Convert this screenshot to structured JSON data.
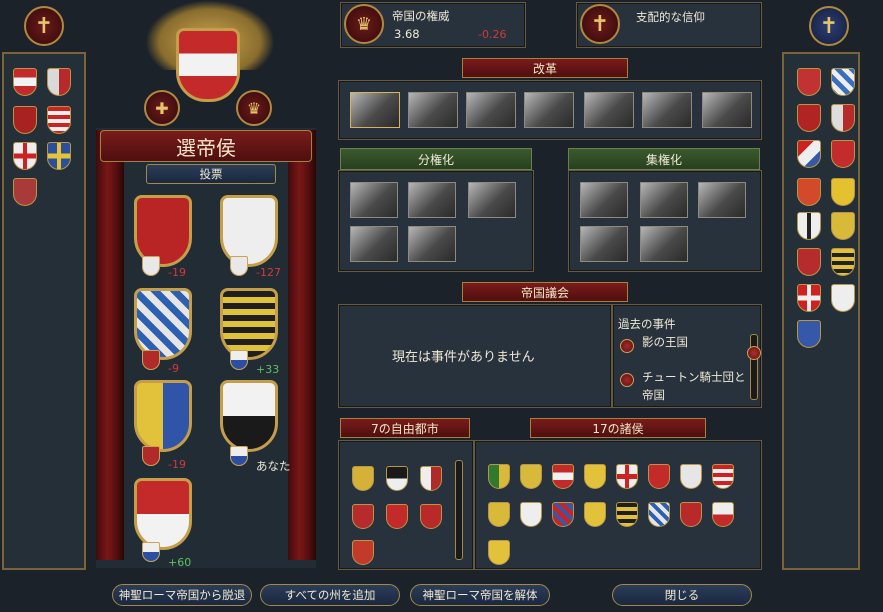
{
  "top_stats": {
    "authority_label": "帝国の権威",
    "authority_value": "3.68",
    "authority_change": "-0.26",
    "faith_label": "支配的な信仰"
  },
  "electors": {
    "title": "選帝侯",
    "vote_label": "投票",
    "entries": [
      {
        "change": "-19"
      },
      {
        "change": "-127"
      },
      {
        "change": "-9"
      },
      {
        "change": "+33"
      },
      {
        "change": "-19"
      },
      {
        "change": "あなた"
      },
      {
        "change": "+60"
      }
    ]
  },
  "reforms": {
    "title": "改革",
    "decentralize_label": "分権化",
    "centralize_label": "集権化"
  },
  "diet": {
    "title": "帝国議会",
    "empty_text": "現在は事件がありません",
    "past_events_label": "過去の事件",
    "past_events": [
      "影の王国",
      "チュートン騎士団と帝国"
    ]
  },
  "free_cities": {
    "title": "7の自由都市"
  },
  "princes": {
    "title": "17の諸侯"
  },
  "buttons": {
    "leave": "神聖ローマ帝国から脱退",
    "add_all": "すべての州を追加",
    "dismantle": "神聖ローマ帝国を解体",
    "close": "閉じる"
  },
  "colors": {
    "accent": "#7a1b1b",
    "gold": "#c59e4a",
    "panel": "#27323c"
  }
}
